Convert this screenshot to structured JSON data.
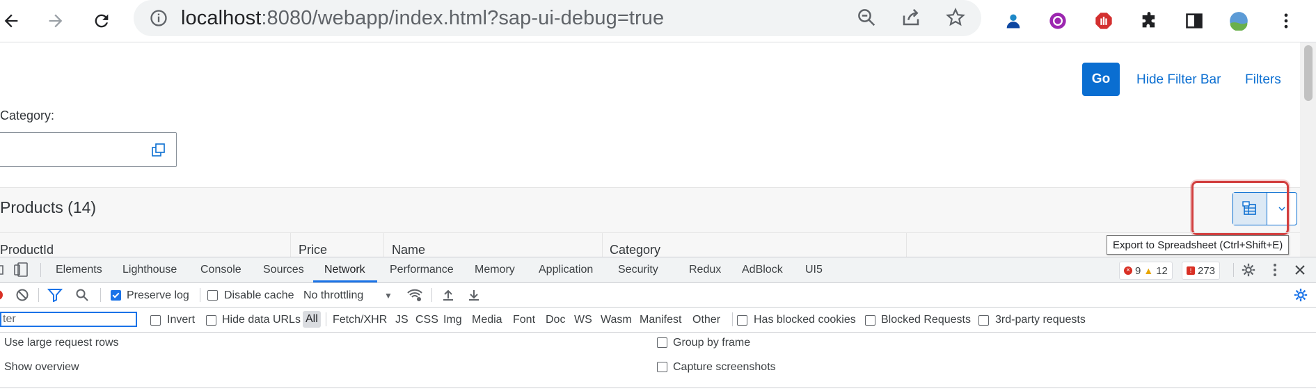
{
  "browser": {
    "url_host": "localhost",
    "url_rest": ":8080/webapp/index.html?sap-ui-debug=true",
    "icons": [
      "back-arrow-icon",
      "forward-arrow-icon",
      "reload-icon",
      "site-info-icon",
      "zoom-out-icon",
      "share-icon",
      "bookmark-star-icon",
      "ext-person-icon",
      "ext-purple-icon",
      "ext-stop-icon",
      "extensions-puzzle-icon",
      "side-panel-icon",
      "profile-avatar-icon",
      "menu-kebab-icon"
    ]
  },
  "filterbar": {
    "go_label": "Go",
    "hide_label": "Hide Filter Bar",
    "filters_label": "Filters",
    "category_label": "Category:",
    "category_value": ""
  },
  "table": {
    "title": "Products (14)",
    "columns": [
      "ProductId",
      "Price",
      "Name",
      "Category"
    ],
    "export_tooltip": "Export to Spreadsheet (Ctrl+Shift+E)"
  },
  "devtools": {
    "tabs": [
      "Elements",
      "Lighthouse",
      "Console",
      "Sources",
      "Network",
      "Performance",
      "Memory",
      "Application",
      "Security",
      "Redux",
      "AdBlock",
      "UI5"
    ],
    "active_tab": "Network",
    "errors": "9",
    "warnings": "12",
    "issues": "273",
    "preserve_log": "Preserve log",
    "disable_cache": "Disable cache",
    "throttling": "No throttling",
    "filter_value": "ter",
    "invert": "Invert",
    "hide_data_urls": "Hide data URLs",
    "type_filters": [
      "All",
      "Fetch/XHR",
      "JS",
      "CSS",
      "Img",
      "Media",
      "Font",
      "Doc",
      "WS",
      "Wasm",
      "Manifest",
      "Other"
    ],
    "has_blocked_cookies": "Has blocked cookies",
    "blocked_requests": "Blocked Requests",
    "third_party": "3rd-party requests",
    "large_rows": "Use large request rows",
    "show_overview": "Show overview",
    "group_by_frame": "Group by frame",
    "capture_screenshots": "Capture screenshots"
  }
}
